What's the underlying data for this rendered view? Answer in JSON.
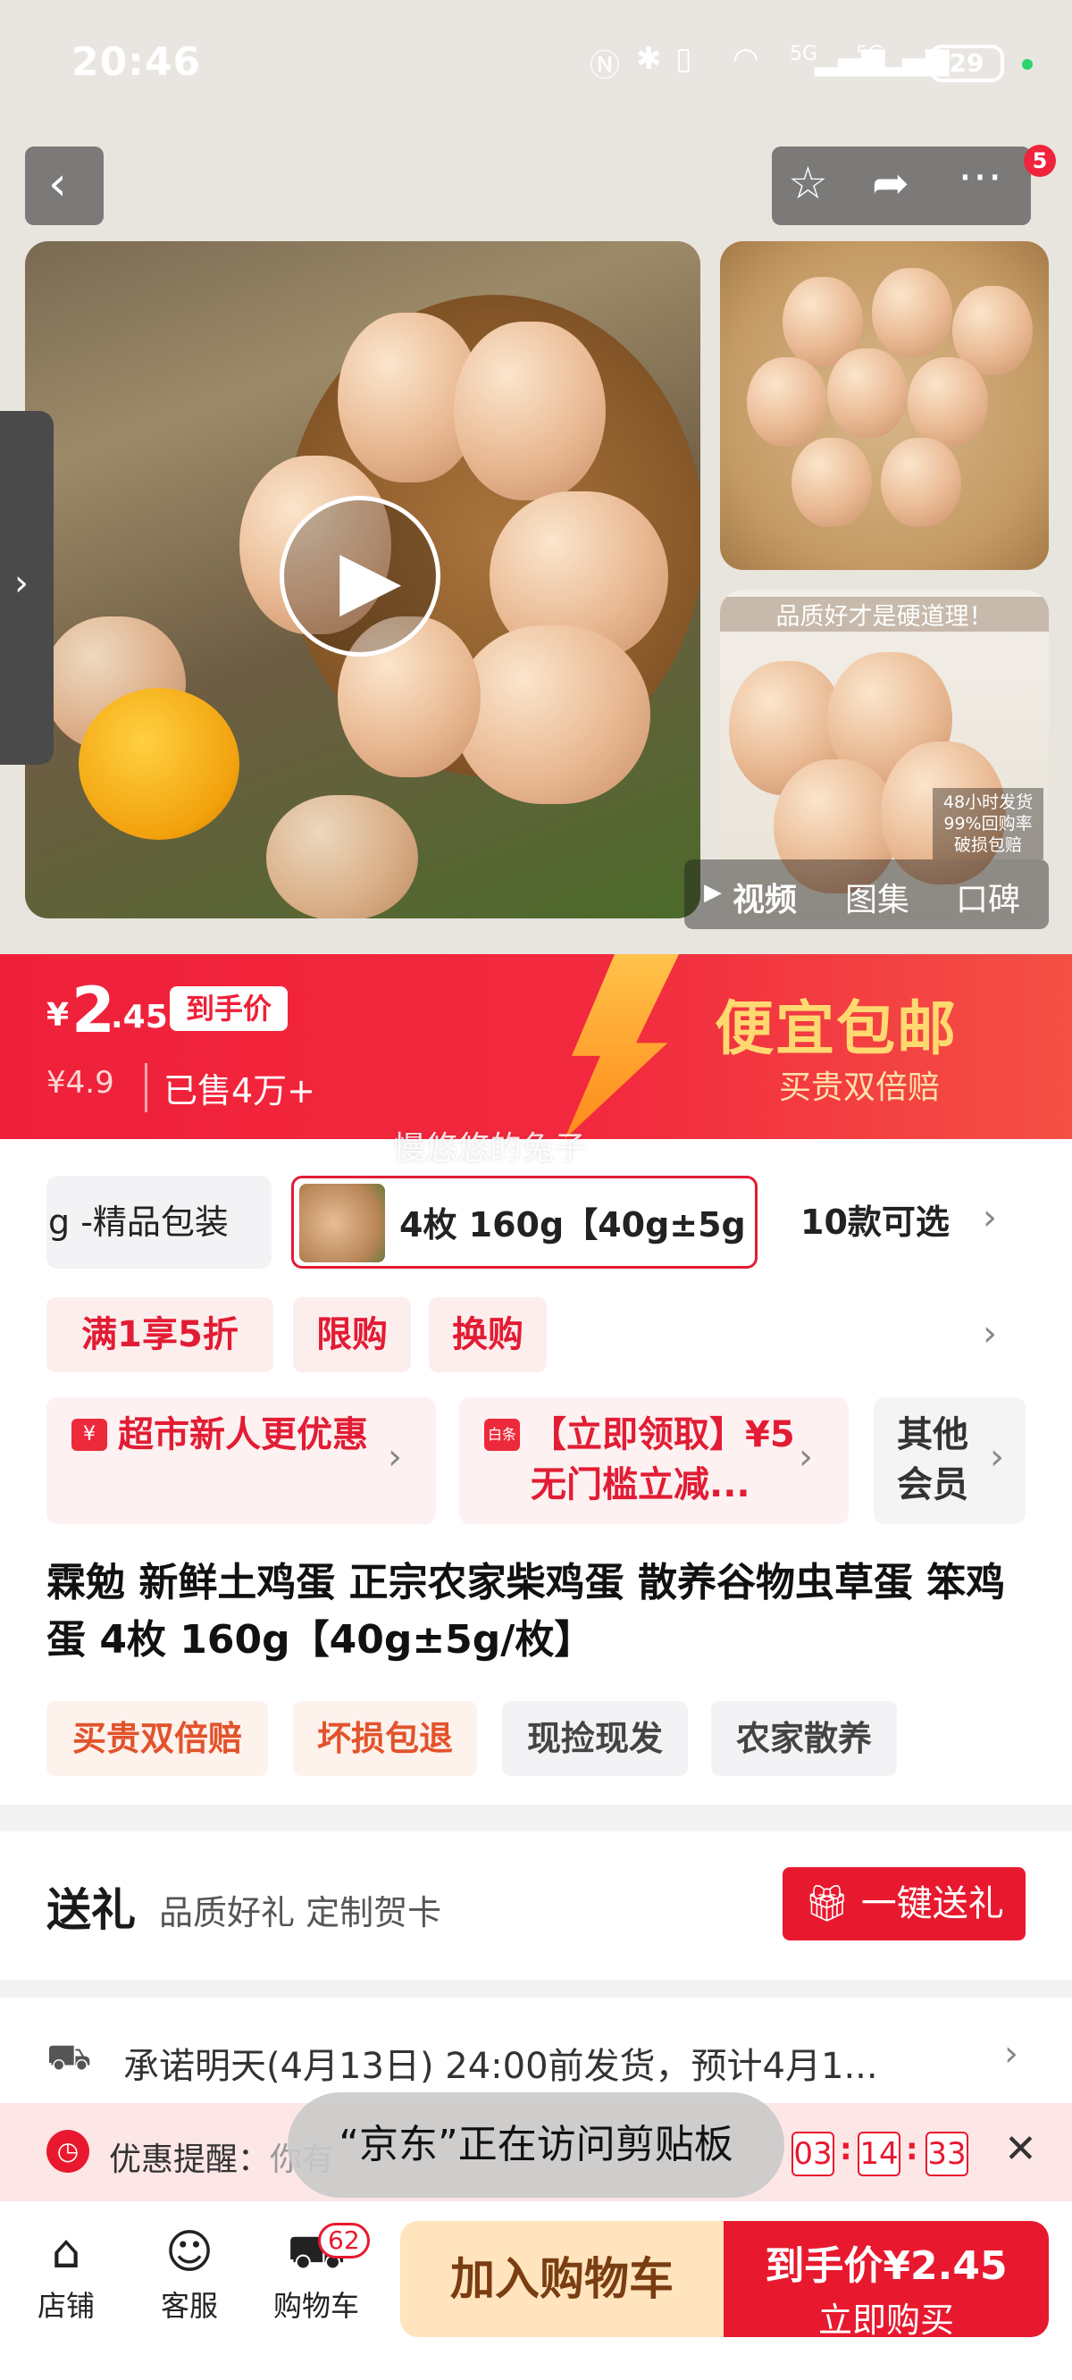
{
  "status_bar": {
    "time": "20:46",
    "battery": "29",
    "net1": "5G",
    "net2": "5G"
  },
  "header": {
    "actions_badge": "5"
  },
  "gallery": {
    "thumb2_caption": "品质好才是硬道理！",
    "thumb2_note": "48小时发货 99%回购率 破损包赔",
    "media_tabs": [
      "视频",
      "图集",
      "口碑"
    ]
  },
  "price": {
    "currency": "¥",
    "integer": "2",
    "decimal": ".45",
    "tag": "到手价",
    "original": "¥4.9",
    "sold": "已售4万+",
    "promo_main": "便宜包邮",
    "promo_sub": "买贵双倍赔",
    "overlay_text": "慢悠悠的兔子"
  },
  "variants": {
    "items": [
      "g -精品包装",
      "4枚 160g【40g±5g"
    ],
    "count_label": "10款可选"
  },
  "promos": [
    "满1享5折",
    "限购",
    "换购"
  ],
  "coupons": [
    {
      "icon": "¥",
      "text": "超市新人更优惠"
    },
    {
      "icon": "白条",
      "text": "【立即领取】¥5 无门槛立减..."
    },
    {
      "icon": "",
      "text": "其他会员"
    }
  ],
  "product": {
    "title": "霖勉 新鲜土鸡蛋 正宗农家柴鸡蛋 散养谷物虫草蛋 笨鸡蛋 4枚 160g【40g±5g/枚】",
    "tags": [
      "买贵双倍赔",
      "坏损包退",
      "现捡现发",
      "农家散养"
    ]
  },
  "gift": {
    "title": "送礼",
    "subtitle": "品质好礼 定制贺卡",
    "button": "一键送礼"
  },
  "delivery": {
    "text": "承诺明天(4月13日) 24:00前发货，预计4月1..."
  },
  "reminder": {
    "label": "优惠提醒：",
    "hidden_text": "你有",
    "countdown": [
      "03",
      "14",
      "33"
    ],
    "toast": "“京东”正在访问剪贴板"
  },
  "bottom_bar": {
    "shop": "店铺",
    "service": "客服",
    "cart": "购物车",
    "cart_count": "62",
    "add_to_cart": "加入购物车",
    "buy_price_label": "到手价¥2.45",
    "buy_now": "立即购买"
  },
  "colors": {
    "accent": "#e8192f",
    "promo_bg": "#f0203a",
    "add_cart_bg": "#ffe4bd"
  }
}
